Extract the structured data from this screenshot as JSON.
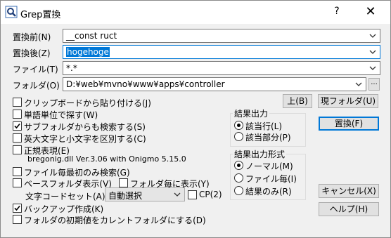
{
  "window": {
    "title": "Grep置換",
    "help_label": "?",
    "close_label": "✕"
  },
  "fields": {
    "before": {
      "label": "置換前(N)",
      "value": "__const ruct"
    },
    "after": {
      "label": "置換後(Z)",
      "value": "hogehoge"
    },
    "file": {
      "label": "ファイル(T)",
      "value": "*.*"
    },
    "folder": {
      "label": "フォルダ(O)",
      "value": "D:¥web¥mvno¥www¥apps¥controller",
      "browse_label": "..."
    }
  },
  "buttons": {
    "up": "上(B)",
    "current_folder": "現フォルダ(U)",
    "replace": "置換(F)",
    "cancel": "キャンセル(X)",
    "help": "ヘルプ(H)"
  },
  "options": {
    "paste_clipboard": {
      "label": "クリップボードから貼り付ける(J)",
      "checked": false
    },
    "word_unit": {
      "label": "単語単位で探す(W)",
      "checked": false
    },
    "subfolders": {
      "label": "サブフォルダからも検索する(S)",
      "checked": true
    },
    "case_sensitive": {
      "label": "英大文字と小文字を区別する(C)",
      "checked": false
    },
    "regex": {
      "label": "正規表現(E)",
      "checked": false,
      "info": "bregonig.dll Ver.3.06 with Onigmo 5.15.0"
    },
    "first_match_per_file": {
      "label": "ファイル毎最初のみ検索(G)",
      "checked": false
    },
    "base_folder": {
      "label": "ベースフォルダ表示(V)",
      "checked": false
    },
    "per_folder": {
      "label": "フォルダ毎に表示(Y)",
      "checked": false
    },
    "charset": {
      "label": "文字コードセット(A)",
      "value": "自動選択"
    },
    "cp": {
      "label": "CP(2)",
      "checked": false
    },
    "backup": {
      "label": "バックアップ作成(K)",
      "checked": true
    },
    "init_folder": {
      "label": "フォルダの初期値をカレントフォルダにする(D)",
      "checked": false
    }
  },
  "output_group": {
    "title": "結果出力",
    "options": [
      "該当行(L)",
      "該当部分(P)"
    ],
    "selected": 0
  },
  "format_group": {
    "title": "結果出力形式",
    "options": [
      "ノーマル(M)",
      "ファイル毎(I)",
      "結果のみ(R)"
    ],
    "selected": 0
  }
}
